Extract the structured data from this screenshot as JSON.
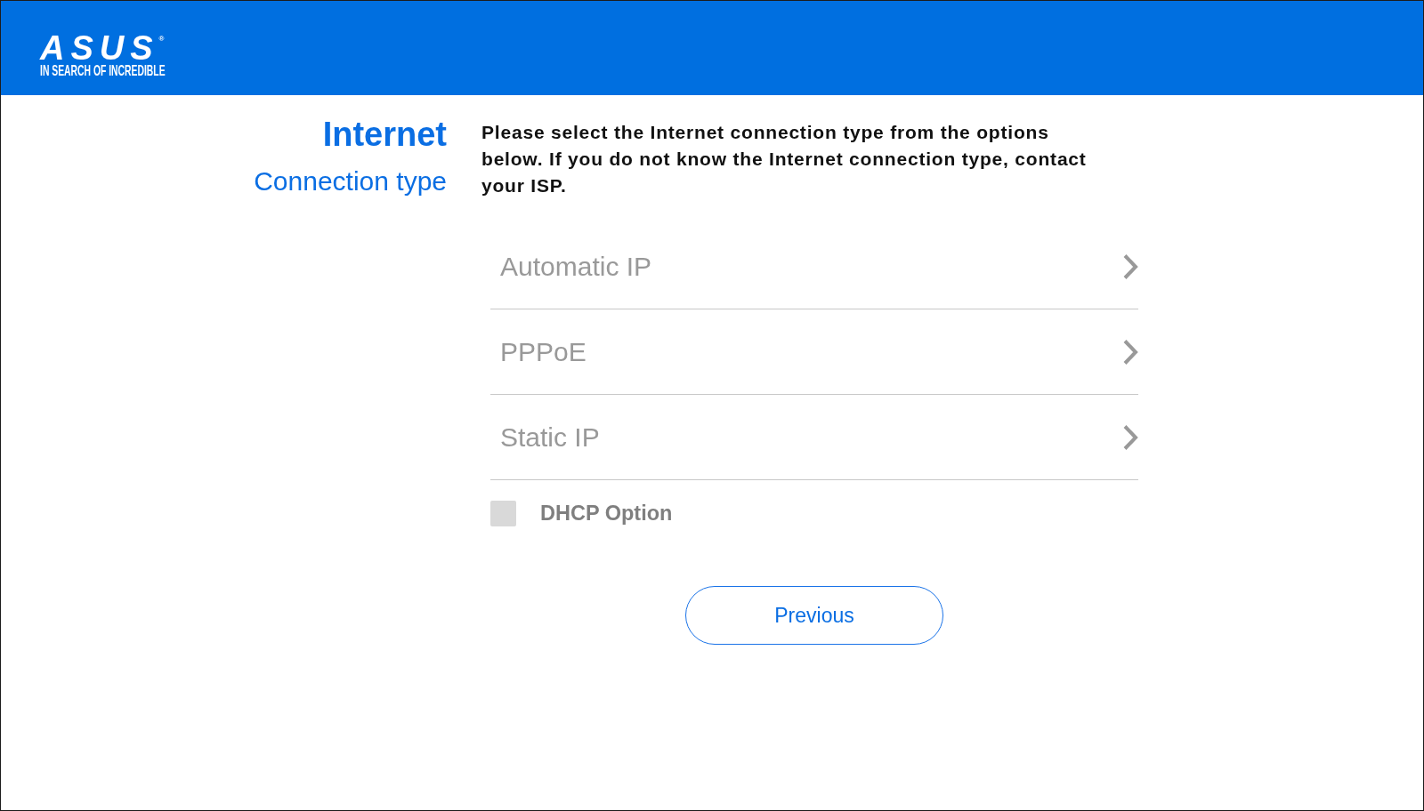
{
  "header": {
    "logo": {
      "wordmark": "ASUS$^{®}$",
      "tagline": "IN SEARCH OF INCREDIBLE"
    }
  },
  "section": {
    "title": "Internet",
    "subtitle": "Connection type"
  },
  "instructions": "Please select the Internet connection type from the options below. If you do not know the Internet connection type, contact your ISP.",
  "connection_types": [
    {
      "label": "Automatic IP"
    },
    {
      "label": "PPPoE"
    },
    {
      "label": "Static IP"
    }
  ],
  "dhcp_option": {
    "label": "DHCP Option",
    "checked": false
  },
  "buttons": [
    {
      "label": "Previous",
      "kind": "outline"
    }
  ]
}
